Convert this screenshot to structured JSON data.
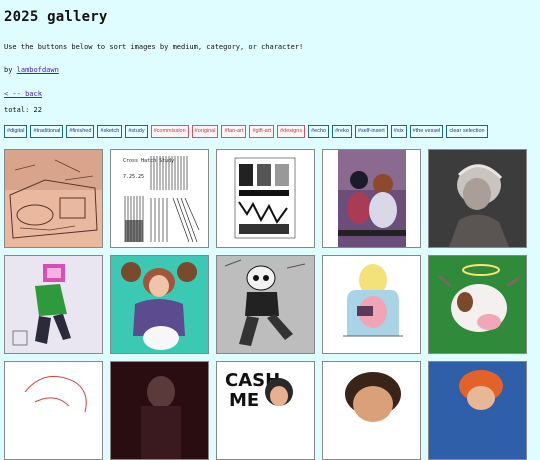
{
  "header": {
    "title": "2025 gallery",
    "description": "Use the buttons below to sort images by medium, category, or character!",
    "by_prefix": "by ",
    "author": "lambofdawn"
  },
  "nav": {
    "back_label": "< -- back"
  },
  "summary": {
    "total_text": "total: 22"
  },
  "filters": [
    {
      "label": "#digital",
      "style": "teal"
    },
    {
      "label": "#traditional",
      "style": "teal"
    },
    {
      "label": "#finished",
      "style": "teal"
    },
    {
      "label": "#sketch",
      "style": "teal"
    },
    {
      "label": "#study",
      "style": "teal"
    },
    {
      "label": "#commission",
      "style": "pink"
    },
    {
      "label": "#original",
      "style": "pink"
    },
    {
      "label": "#fan-art",
      "style": "pink"
    },
    {
      "label": "#gift-art",
      "style": "pink"
    },
    {
      "label": "#designs",
      "style": "pink"
    },
    {
      "label": "#echo",
      "style": "teal"
    },
    {
      "label": "#reko",
      "style": "teal"
    },
    {
      "label": "#self-insert",
      "style": "teal"
    },
    {
      "label": "#six",
      "style": "teal"
    },
    {
      "label": "#the vessel",
      "style": "teal"
    },
    {
      "label": "clear selection",
      "style": "teal"
    }
  ],
  "thumb_sketch": {
    "title": "Cross Hatch Study",
    "date": "7.25.25"
  }
}
